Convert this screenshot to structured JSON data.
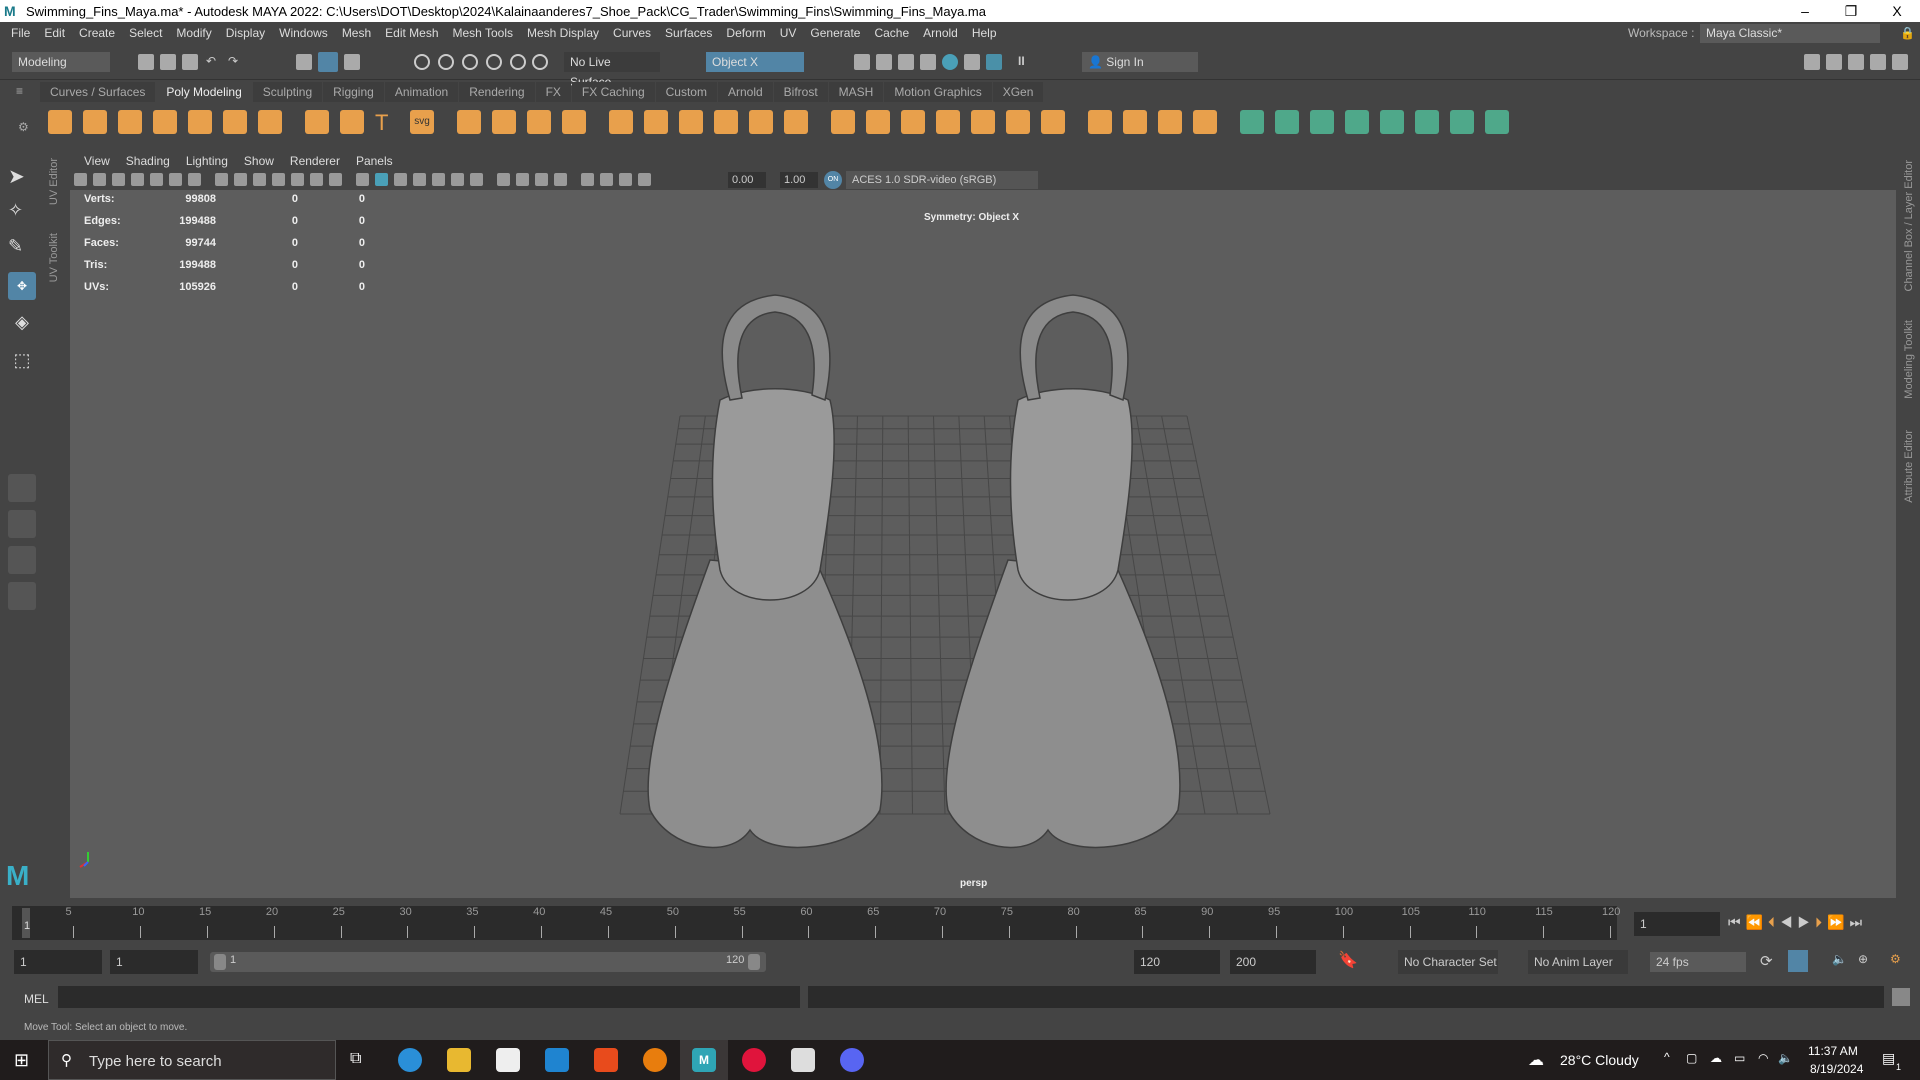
{
  "window": {
    "title": "Swimming_Fins_Maya.ma* - Autodesk MAYA 2022: C:\\Users\\DOT\\Desktop\\2024\\Kalainaanderes7_Shoe_Pack\\CG_Trader\\Swimming_Fins\\Swimming_Fins_Maya.ma",
    "minimize": "–",
    "restore": "❐",
    "close": "X"
  },
  "menu": [
    "File",
    "Edit",
    "Create",
    "Select",
    "Modify",
    "Display",
    "Windows",
    "Mesh",
    "Edit Mesh",
    "Mesh Tools",
    "Mesh Display",
    "Curves",
    "Surfaces",
    "Deform",
    "UV",
    "Generate",
    "Cache",
    "Arnold",
    "Help"
  ],
  "workspace": {
    "label": "Workspace :",
    "value": "Maya Classic*"
  },
  "status": {
    "mode": "Modeling",
    "live_surface": "No Live Surface",
    "symmetry": "Object X",
    "sign_in": "Sign In"
  },
  "shelf_tabs": [
    "Curves / Surfaces",
    "Poly Modeling",
    "Sculpting",
    "Rigging",
    "Animation",
    "Rendering",
    "FX",
    "FX Caching",
    "Custom",
    "Arnold",
    "Bifrost",
    "MASH",
    "Motion Graphics",
    "XGen"
  ],
  "shelf_active": "Poly Modeling",
  "shelf_svg_label": "svg",
  "shelf_text_label": "T",
  "left_tabs": [
    "UV Editor",
    "UV Toolkit"
  ],
  "right_tabs": [
    "Channel Box / Layer Editor",
    "Modeling Toolkit",
    "Attribute Editor"
  ],
  "panel_menu": [
    "View",
    "Shading",
    "Lighting",
    "Show",
    "Renderer",
    "Panels"
  ],
  "panel_toolbar": {
    "exposure": "0.00",
    "gamma": "1.00",
    "color_space": "ACES 1.0 SDR-video (sRGB)",
    "on": "ON"
  },
  "hud": {
    "rows": [
      {
        "label": "Verts:",
        "v": "99808",
        "a": "0",
        "b": "0"
      },
      {
        "label": "Edges:",
        "v": "199488",
        "a": "0",
        "b": "0"
      },
      {
        "label": "Faces:",
        "v": "99744",
        "a": "0",
        "b": "0"
      },
      {
        "label": "Tris:",
        "v": "199488",
        "a": "0",
        "b": "0"
      },
      {
        "label": "UVs:",
        "v": "105926",
        "a": "0",
        "b": "0"
      }
    ],
    "symmetry": "Symmetry: Object X",
    "camera": "persp"
  },
  "timeline": {
    "ticks": [
      "5",
      "10",
      "15",
      "20",
      "25",
      "30",
      "35",
      "40",
      "45",
      "50",
      "55",
      "60",
      "65",
      "70",
      "75",
      "80",
      "85",
      "90",
      "95",
      "100",
      "105",
      "110",
      "115",
      "120"
    ],
    "current": "1",
    "current_field": "1"
  },
  "range": {
    "start": "1",
    "playback_start": "1",
    "slider_start": "1",
    "slider_end": "120",
    "playback_end": "120",
    "end": "200",
    "character_set": "No Character Set",
    "anim_layer": "No Anim Layer",
    "fps": "24 fps"
  },
  "command": {
    "lang": "MEL"
  },
  "help_line": "Move Tool: Select an object to move.",
  "taskbar": {
    "search": "Type here to search",
    "weather": "28°C  Cloudy",
    "time": "11:37 AM",
    "date": "8/19/2024",
    "notif": "1"
  },
  "colors": {
    "accent": "#5285a6",
    "shelf_orange": "#e8a04c",
    "shelf_green": "#4fa88a",
    "viewport": "#5d5d5d"
  }
}
